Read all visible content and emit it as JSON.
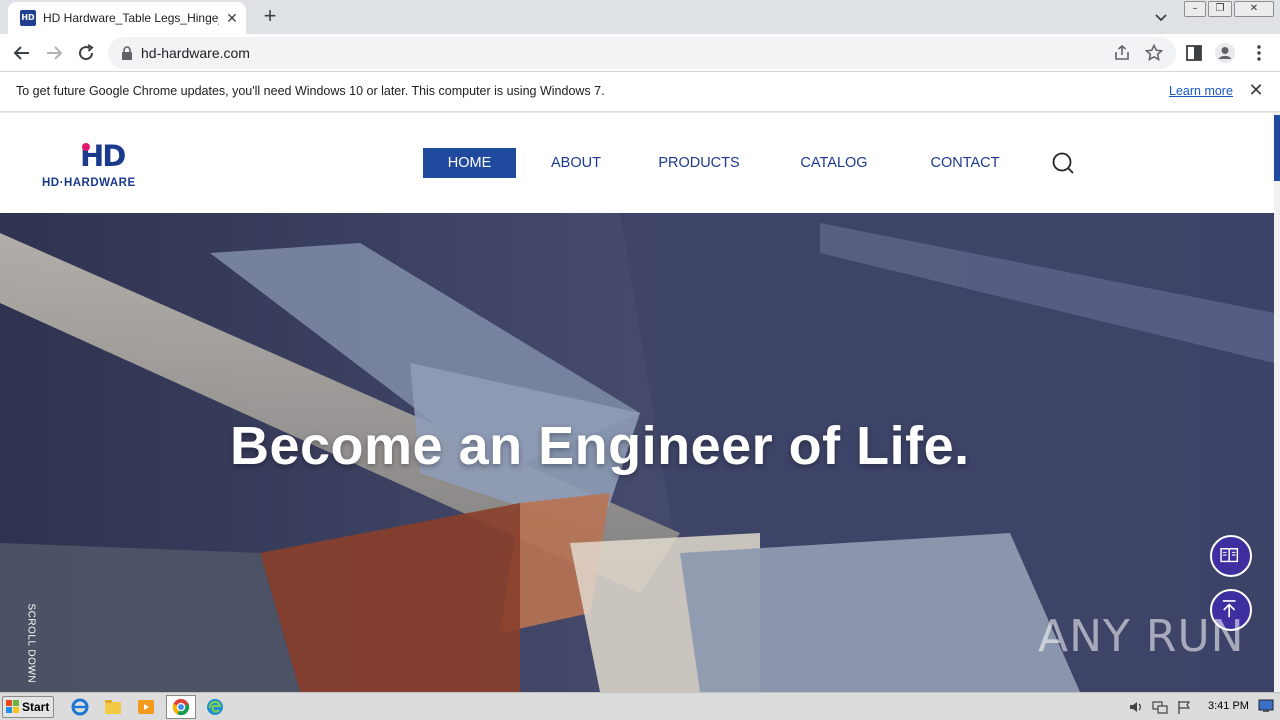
{
  "browser": {
    "tab_title": "HD Hardware_Table Legs_Hinge_Metal",
    "tab_favicon_text": "HD",
    "url": "hd-hardware.com"
  },
  "infobar": {
    "message": "To get future Google Chrome updates, you'll need Windows 10 or later. This computer is using Windows 7.",
    "link": "Learn more"
  },
  "site": {
    "logo_mark": "HD",
    "logo_text": "HD·HARDWARE",
    "nav": [
      {
        "label": "HOME",
        "active": true
      },
      {
        "label": "ABOUT",
        "active": false
      },
      {
        "label": "PRODUCTS",
        "active": false
      },
      {
        "label": "CATALOG",
        "active": false
      },
      {
        "label": "CONTACT",
        "active": false
      }
    ],
    "accent": "#1f4a9e",
    "hero_title": "Become an Engineer of Life.",
    "scroll_down": "SCROLL DOWN",
    "watermark": "ANY RUN"
  },
  "taskbar": {
    "start_label": "Start",
    "clock": "3:41 PM"
  }
}
